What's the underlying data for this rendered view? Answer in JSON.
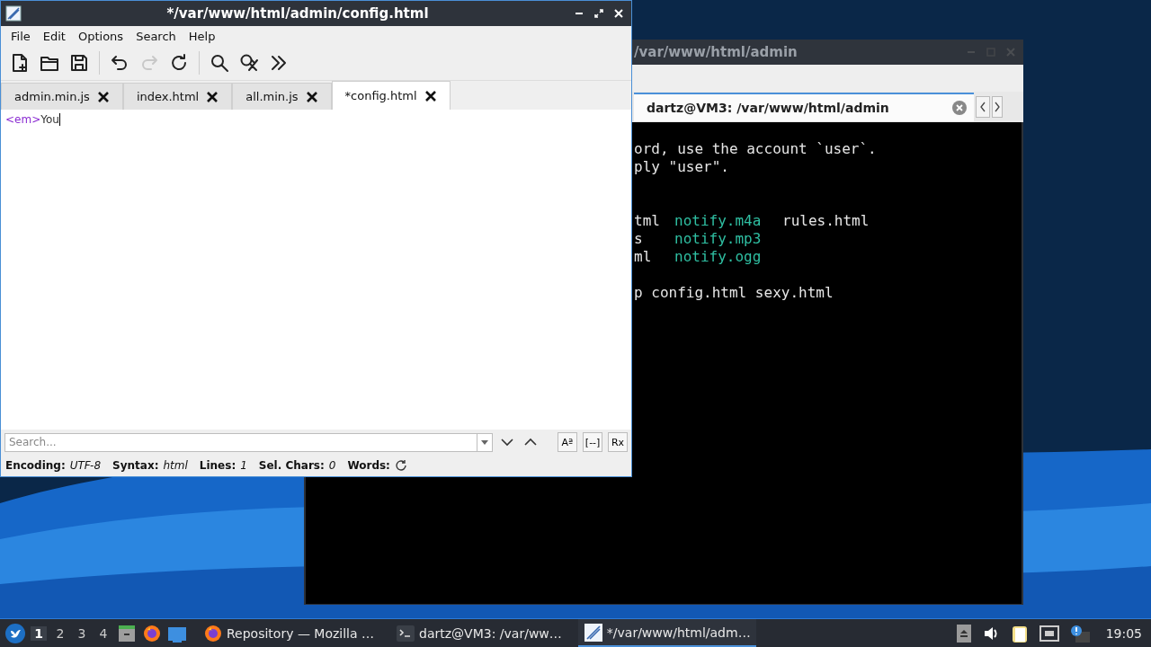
{
  "terminal_window": {
    "title": "/var/www/html/admin",
    "tab": {
      "label": "dartz@VM3: /var/www/html/admin",
      "selected": true
    },
    "blocks": [
      {
        "kind": "top",
        "lines": [
          [
            {
              "text": "ord, use the account `user`.",
              "kind": "plain"
            }
          ],
          [
            {
              "text": "ply \"user\".",
              "kind": "plain"
            }
          ]
        ]
      },
      {
        "kind": "wide",
        "lines": [
          [
            {
              "text": "tml",
              "kind": "plain"
            },
            {
              "text": "notify.m4a",
              "kind": "media"
            },
            {
              "text": "rules.html",
              "kind": "plain"
            }
          ],
          [
            {
              "text": "s",
              "kind": "plain"
            },
            {
              "text": "notify.mp3",
              "kind": "media"
            }
          ],
          [
            {
              "text": "ml",
              "kind": "plain"
            },
            {
              "text": "notify.ogg",
              "kind": "media"
            }
          ]
        ]
      },
      {
        "kind": "narrow",
        "lines": [
          [
            {
              "text": "p config.html sexy.html",
              "kind": "plain"
            }
          ]
        ]
      }
    ]
  },
  "editor_window": {
    "title": "*/var/www/html/admin/config.html",
    "menu": [
      "File",
      "Edit",
      "Options",
      "Search",
      "Help"
    ],
    "toolbar": [
      {
        "kind": "new",
        "disabled": false
      },
      {
        "kind": "open",
        "disabled": false
      },
      {
        "kind": "save",
        "disabled": false
      },
      {
        "kind": "sep"
      },
      {
        "kind": "undo",
        "disabled": false
      },
      {
        "kind": "redo",
        "disabled": true
      },
      {
        "kind": "reload",
        "disabled": false
      },
      {
        "kind": "sep"
      },
      {
        "kind": "find",
        "disabled": false
      },
      {
        "kind": "replace",
        "disabled": false
      },
      {
        "kind": "more",
        "disabled": false
      }
    ],
    "tabs": [
      {
        "label": "admin.min.js",
        "selected": false
      },
      {
        "label": "index.html",
        "selected": false
      },
      {
        "label": "all.min.js",
        "selected": false
      },
      {
        "label": "*config.html",
        "selected": true
      }
    ],
    "code": [
      {
        "text": "<em>",
        "kind": "tag"
      },
      {
        "text": "You",
        "kind": "text"
      }
    ],
    "search": {
      "placeholder": "Search..."
    },
    "search_options": [
      "Aª",
      "[--]",
      "Rx"
    ],
    "status_bar": [
      {
        "label": "Encoding:",
        "value": "UTF-8"
      },
      {
        "label": "Syntax:",
        "value": "html"
      },
      {
        "label": "Lines:",
        "value": "1"
      },
      {
        "label": "Sel. Chars:",
        "value": "0"
      },
      {
        "label": "Words:"
      }
    ]
  },
  "taskbar": {
    "workspaces": [
      {
        "label": "1",
        "selected": true
      },
      {
        "label": "2",
        "selected": false
      },
      {
        "label": "3",
        "selected": false
      },
      {
        "label": "4",
        "selected": false
      }
    ],
    "tasks": [
      {
        "label": "Repository — Mozilla …",
        "kind": "browser",
        "selected": false
      },
      {
        "label": "dartz@VM3: /var/ww…",
        "kind": "terminal",
        "selected": false
      },
      {
        "label": "*/var/www/html/adm…",
        "kind": "editor",
        "selected": true
      }
    ],
    "clock": "19:05"
  }
}
